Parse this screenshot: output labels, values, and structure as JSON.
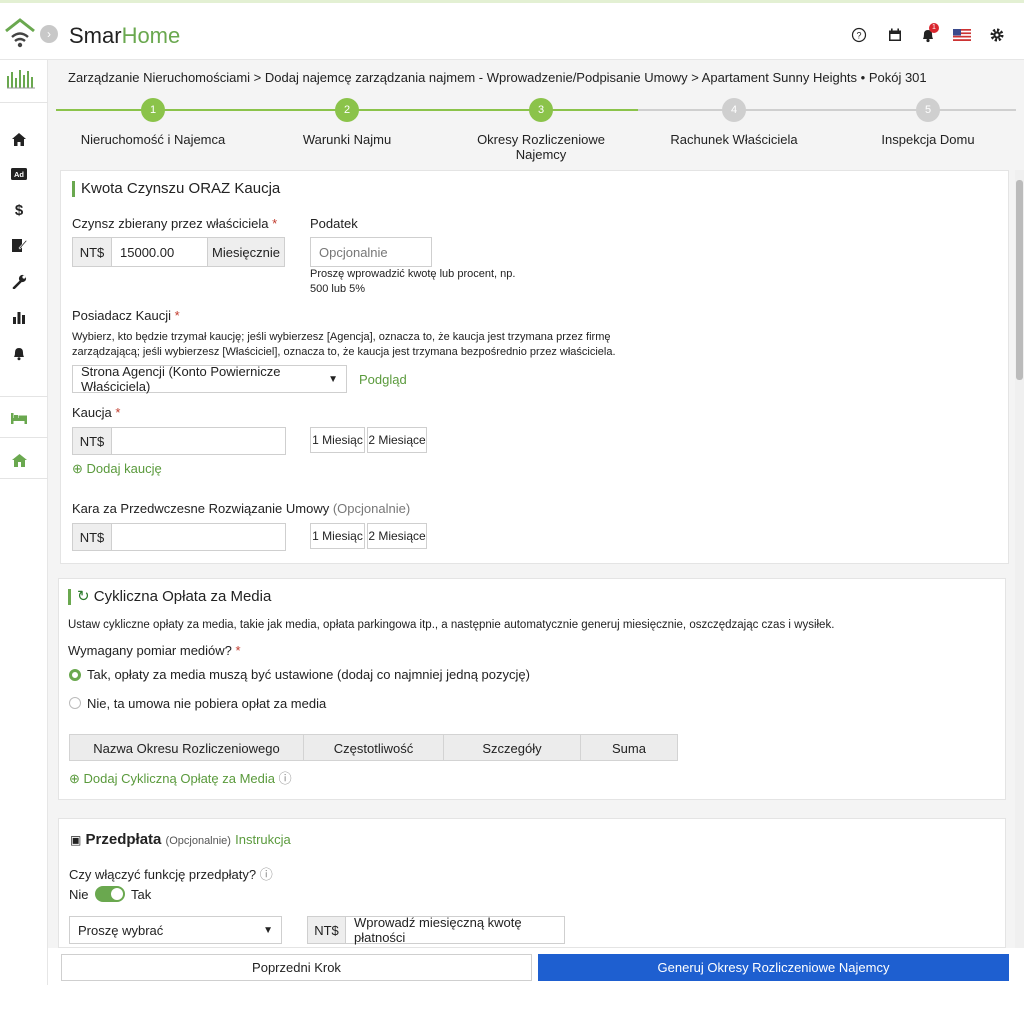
{
  "app": {
    "brand_prefix": "Smar",
    "brand_suffix": "Home",
    "accent": "#6aa84f",
    "primary": "#1e5fd0",
    "notif_count": "1"
  },
  "breadcrumb": "Zarządzanie Nieruchomościami > Dodaj najemcę zarządzania najmem - Wprowadzenie/Podpisanie Umowy > Apartament Sunny Heights • Pokój 301",
  "steps": [
    {
      "num": "1",
      "label": "Nieruchomość i Najemca",
      "state": "done"
    },
    {
      "num": "2",
      "label": "Warunki Najmu",
      "state": "done"
    },
    {
      "num": "3",
      "label": "Okresy Rozliczeniowe Najemcy",
      "state": "active"
    },
    {
      "num": "4",
      "label": "Rachunek Właściciela",
      "state": "todo"
    },
    {
      "num": "5",
      "label": "Inspekcja Domu",
      "state": "todo"
    }
  ],
  "rent": {
    "title": "Kwota Czynszu ORAZ Kaucja",
    "rent_label": "Czynsz zbierany przez właściciela",
    "currency": "NT$",
    "rent_value": "15000.00",
    "period": "Miesięcznie",
    "tax_label": "Podatek",
    "tax_placeholder": "Opcjonalnie",
    "tax_help": "Proszę wprowadzić kwotę lub procent, np. 500 lub 5%",
    "holder_label": "Posiadacz Kaucji",
    "holder_help": "Wybierz, kto będzie trzymał kaucję; jeśli wybierzesz [Agencja], oznacza to, że kaucja jest trzymana przez firmę zarządzającą; jeśli wybierzesz [Właściciel], oznacza to, że kaucja jest trzymana bezpośrednio przez właściciela.",
    "holder_value": "Strona Agencji (Konto Powiernicze Właściciela)",
    "preview": "Podgląd",
    "deposit_label": "Kaucja",
    "one_month": "1 Miesiąc",
    "two_months": "2 Miesiące",
    "add_deposit": "Dodaj kaucję",
    "penalty_label": "Kara za Przedwczesne Rozwiązanie Umowy",
    "optional": "(Opcjonalnie)"
  },
  "utilities": {
    "title": "Cykliczna Opłata za Media",
    "desc": "Ustaw cykliczne opłaty za media, takie jak media, opłata parkingowa itp., a następnie automatycznie generuj miesięcznie, oszczędzając czas i wysiłek.",
    "question": "Wymagany pomiar mediów?",
    "opt_yes": "Tak, opłaty za media muszą być ustawione (dodaj co najmniej jedną pozycję)",
    "opt_no": "Nie, ta umowa nie pobiera opłat za media",
    "columns": [
      "Nazwa Okresu Rozliczeniowego",
      "Częstotliwość",
      "Szczegóły",
      "Suma"
    ],
    "add": "Dodaj Cykliczną Opłatę za Media"
  },
  "prepay": {
    "title": "Przedpłata",
    "optional": "(Opcjonalnie)",
    "instructions": "Instrukcja",
    "question": "Czy włączyć funkcję przedpłaty?",
    "no": "Nie",
    "yes": "Tak",
    "select_placeholder": "Proszę wybrać",
    "currency": "NT$",
    "amount_placeholder": "Wprowadź miesięczną kwotę płatności"
  },
  "footer": {
    "prev": "Poprzedni Krok",
    "generate": "Generuj Okresy Rozliczeniowe Najemcy"
  }
}
